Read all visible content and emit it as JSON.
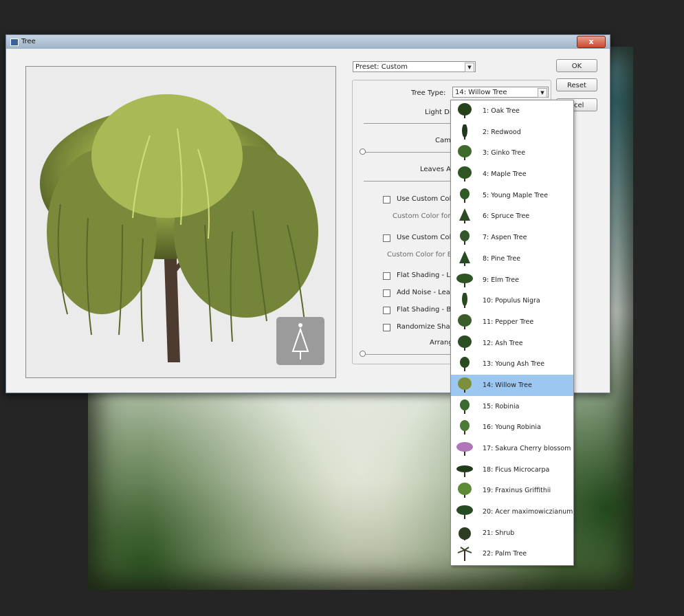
{
  "window": {
    "title": "Tree",
    "close_label": "x"
  },
  "preset": {
    "label": "Preset: Custom"
  },
  "buttons": {
    "ok": "OK",
    "reset": "Reset",
    "cancel": "ncel"
  },
  "tree_type": {
    "label": "Tree Type:",
    "selected": "14: Willow Tree"
  },
  "controls": {
    "light_direction": "Light Di",
    "camera": "Came",
    "leaves_amount": "Leaves A",
    "use_custom_color_leaves": "Use Custom Colo",
    "custom_color_leaves": "Custom Color for L",
    "use_custom_color_branches": "Use Custom Colo",
    "custom_color_branches": "Custom Color for Br",
    "flat_shading_leaves": "Flat Shading - Le",
    "add_noise_leaves": "Add Noise - Leav",
    "flat_shading_branches": "Flat Shading - Br",
    "randomize_shapes": "Randomize Shap",
    "arrange": "Arrang"
  },
  "tree_types": [
    {
      "label": "1: Oak Tree",
      "color": "#27431b",
      "shape": "round"
    },
    {
      "label": "2: Redwood",
      "color": "#1f3a1a",
      "shape": "tall"
    },
    {
      "label": "3: Ginko Tree",
      "color": "#3b6a2a",
      "shape": "round"
    },
    {
      "label": "4: Maple Tree",
      "color": "#2f5522",
      "shape": "round"
    },
    {
      "label": "5: Young Maple Tree",
      "color": "#2e5a24",
      "shape": "small"
    },
    {
      "label": "6: Spruce Tree",
      "color": "#2b4a25",
      "shape": "cone"
    },
    {
      "label": "7: Aspen Tree",
      "color": "#33572a",
      "shape": "small"
    },
    {
      "label": "8: Pine Tree",
      "color": "#2a4a24",
      "shape": "cone"
    },
    {
      "label": "9: Elm Tree",
      "color": "#2d5422",
      "shape": "wide"
    },
    {
      "label": "10: Populus Nigra",
      "color": "#2a4a1f",
      "shape": "tall"
    },
    {
      "label": "11: Pepper Tree",
      "color": "#3a5d2a",
      "shape": "round"
    },
    {
      "label": "12: Ash Tree",
      "color": "#2d4d22",
      "shape": "round"
    },
    {
      "label": "13: Young Ash Tree",
      "color": "#2a4a20",
      "shape": "small"
    },
    {
      "label": "14: Willow Tree",
      "color": "#7d8f3c",
      "shape": "round",
      "selected": true
    },
    {
      "label": "15: Robinia",
      "color": "#3b6a30",
      "shape": "small"
    },
    {
      "label": "16: Young Robinia",
      "color": "#4a7a35",
      "shape": "small"
    },
    {
      "label": "17: Sakura Cherry blossom",
      "color": "#b077b8",
      "shape": "wide"
    },
    {
      "label": "18: Ficus Microcarpa",
      "color": "#213c1a",
      "shape": "flat"
    },
    {
      "label": "19: Fraxinus Griffithii",
      "color": "#5d8a35",
      "shape": "round"
    },
    {
      "label": "20: Acer maximowiczianum",
      "color": "#264a22",
      "shape": "wide"
    },
    {
      "label": "21: Shrub",
      "color": "#2d3d22",
      "shape": "bush"
    },
    {
      "label": "22: Palm Tree",
      "color": "#3a4a2a",
      "shape": "palm"
    }
  ]
}
